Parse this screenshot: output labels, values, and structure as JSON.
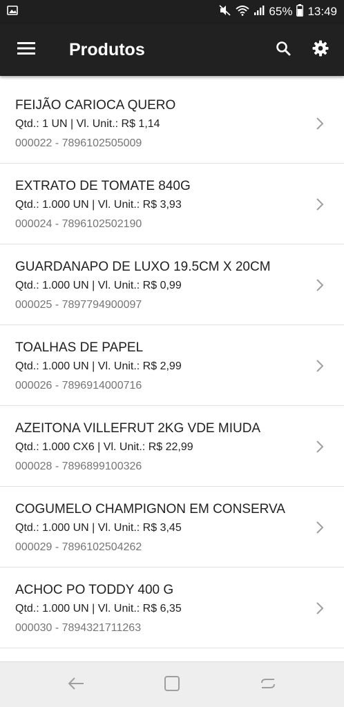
{
  "status_bar": {
    "battery": "65%",
    "time": "13:49",
    "icons": [
      "image-icon",
      "mute-icon",
      "wifi-icon",
      "signal-icon",
      "battery-icon"
    ]
  },
  "app_bar": {
    "title": "Produtos",
    "icons": [
      "menu-icon",
      "search-icon",
      "settings-icon"
    ]
  },
  "products": [
    {
      "name": "FEIJÃO CARIOCA QUERO",
      "details": "Qtd.: 1 UN | Vl. Unit.: R$ 1,14",
      "code": "000022 - 7896102505009"
    },
    {
      "name": "EXTRATO DE TOMATE 840G",
      "details": "Qtd.: 1.000 UN | Vl. Unit.: R$ 3,93",
      "code": "000024 - 7896102502190"
    },
    {
      "name": "GUARDANAPO DE LUXO 19.5CM X 20CM",
      "details": "Qtd.: 1.000 UN | Vl. Unit.: R$ 0,99",
      "code": "000025 - 7897794900097"
    },
    {
      "name": "TOALHAS DE PAPEL",
      "details": "Qtd.: 1.000 UN | Vl. Unit.: R$ 2,99",
      "code": "000026 - 7896914000716"
    },
    {
      "name": "AZEITONA VILLEFRUT 2KG VDE MIUDA",
      "details": "Qtd.: 1.000 CX6 | Vl. Unit.: R$ 22,99",
      "code": "000028 - 7896899100326"
    },
    {
      "name": "COGUMELO CHAMPIGNON EM CONSERVA",
      "details": "Qtd.: 1.000 UN | Vl. Unit.: R$ 3,45",
      "code": "000029 - 7896102504262"
    },
    {
      "name": "ACHOC PO TODDY 400 G",
      "details": "Qtd.: 1.000 UN | Vl. Unit.: R$ 6,35",
      "code": "000030 - 7894321711263"
    }
  ],
  "nav_bar": {
    "icons": [
      "back-icon",
      "home-icon",
      "recent-apps-icon"
    ]
  },
  "colors": {
    "app_bar": "#212121",
    "status_bar": "#1f1f1f",
    "text_primary": "#212121",
    "text_secondary": "#757575",
    "divider": "#e0e0e0",
    "chevron": "#9e9e9e",
    "nav_bar": "#eeeeee"
  }
}
